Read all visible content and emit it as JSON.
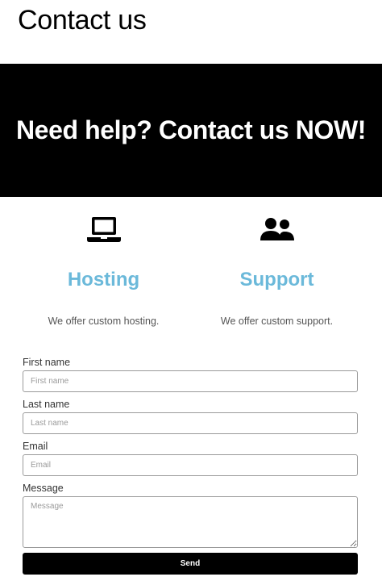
{
  "page": {
    "title": "Contact us"
  },
  "hero": {
    "text": "Need help? Contact us NOW!"
  },
  "services": [
    {
      "icon": "laptop-icon",
      "title": "Hosting",
      "description": "We offer custom hosting."
    },
    {
      "icon": "users-icon",
      "title": "Support",
      "description": "We offer custom support."
    }
  ],
  "form": {
    "first_name": {
      "label": "First name",
      "placeholder": "First name",
      "value": ""
    },
    "last_name": {
      "label": "Last name",
      "placeholder": "Last name",
      "value": ""
    },
    "email": {
      "label": "Email",
      "placeholder": "Email",
      "value": ""
    },
    "message": {
      "label": "Message",
      "placeholder": "Message",
      "value": ""
    },
    "send_label": "Send"
  },
  "colors": {
    "accent": "#6bb9da",
    "hero_bg": "#000000",
    "button_bg": "#000000"
  }
}
